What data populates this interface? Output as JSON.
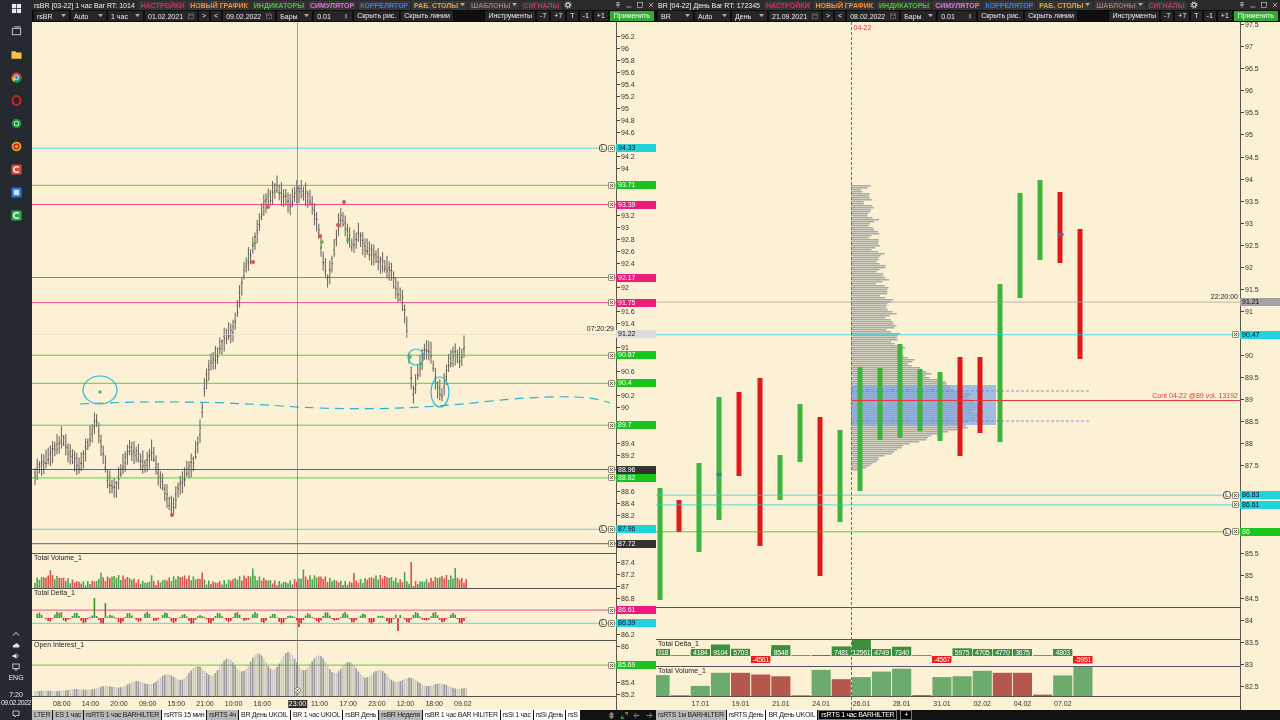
{
  "taskbar": {
    "language": "ENG",
    "time": "7:20",
    "date": "09.02.2022"
  },
  "windows": [
    {
      "kind": "hourly",
      "title": "rsBR [03-22] 1 час Bar RT: 1014",
      "menu": [
        {
          "label": "НАСТРОЙКИ",
          "color": "#e2245e",
          "dropdown": false
        },
        {
          "label": "НОВЫЙ ГРАФИК",
          "color": "#f0903c",
          "dropdown": false
        },
        {
          "label": "ИНДИКАТОРЫ",
          "color": "#4fbf3a",
          "dropdown": false
        },
        {
          "label": "СИМУЛЯТОР",
          "color": "#e070e0",
          "dropdown": false
        },
        {
          "label": "КОРРЕЛЯТОР",
          "color": "#3c7ce0",
          "dropdown": false
        },
        {
          "label": "РАБ. СТОЛЫ",
          "color": "#e0a040",
          "dropdown": true
        },
        {
          "label": "ШАБЛОНЫ",
          "color": "#9a7a6a",
          "dropdown": true
        },
        {
          "label": "СИГНАЛЫ",
          "color": "#c0306a",
          "dropdown": false
        }
      ],
      "toolbar_left": [
        {
          "kind": "select",
          "value": "rsBR"
        },
        {
          "kind": "select",
          "value": "Auto"
        },
        {
          "kind": "select",
          "value": "1 час"
        },
        {
          "kind": "date",
          "value": "01.02.2021"
        },
        {
          "kind": "button",
          "label": ">"
        },
        {
          "kind": "button",
          "label": "<"
        },
        {
          "kind": "date",
          "value": "09.02.2022"
        },
        {
          "kind": "select",
          "value": "Бары"
        },
        {
          "kind": "spin",
          "value": "0.01"
        },
        {
          "kind": "button",
          "label": "Скрыть рис."
        },
        {
          "kind": "button",
          "label": "Скрыть линии"
        }
      ],
      "toolbar_right": [
        {
          "kind": "button",
          "label": "Инструменты"
        },
        {
          "kind": "button",
          "label": "-7"
        },
        {
          "kind": "button",
          "label": "+7"
        },
        {
          "kind": "button",
          "label": "T"
        },
        {
          "kind": "button",
          "label": "-1"
        },
        {
          "kind": "button",
          "label": "+1"
        },
        {
          "kind": "apply",
          "label": "Применить"
        }
      ],
      "price_pane": {
        "chart_data": {
          "type": "bar",
          "categories": [
            null,
            null,
            null,
            null,
            null,
            null,
            null,
            null,
            null,
            null,
            null,
            null,
            null,
            "08:00",
            null,
            null,
            null,
            null,
            null,
            null,
            null,
            null,
            null,
            null,
            null,
            null,
            "14:00",
            null,
            null,
            null,
            null,
            null,
            null,
            null,
            null,
            null,
            null,
            null,
            null,
            "20:00",
            null,
            null,
            null,
            null,
            null,
            null,
            null,
            null,
            null,
            null,
            null,
            null,
            "09:00",
            null,
            null,
            null,
            null,
            null,
            null,
            null,
            null,
            null,
            null,
            null,
            null,
            "15:00",
            null,
            null,
            null,
            null,
            null,
            null,
            null,
            null,
            null,
            null,
            null,
            null,
            "21:00",
            null,
            null,
            null,
            null,
            null,
            null,
            null,
            null,
            null,
            null,
            null,
            null,
            "10:00",
            null,
            null,
            null,
            null,
            null,
            null,
            null,
            null,
            null,
            null,
            null,
            null,
            "16:00",
            null,
            null,
            null,
            null,
            null,
            null,
            null,
            null,
            null,
            null,
            null,
            null,
            null,
            null,
            null,
            null,
            null,
            null,
            null,
            null,
            null,
            null,
            null,
            null,
            null,
            "11:00",
            null,
            null,
            null,
            null,
            null,
            null,
            null,
            null,
            null,
            null,
            null,
            null,
            "17:00",
            null,
            null,
            null,
            null,
            null,
            null,
            null,
            null,
            null,
            null,
            null,
            null,
            "23:00",
            null,
            null,
            null,
            null,
            null,
            null,
            null,
            null,
            null,
            null,
            null,
            null,
            "12:00",
            null,
            null,
            null,
            null,
            null,
            null,
            null,
            null,
            null,
            null,
            null,
            null,
            "18:00",
            null,
            null,
            null,
            null,
            null,
            null,
            null,
            null,
            null,
            null,
            null,
            null,
            "09.02",
            null,
            null,
            null,
            null,
            null,
            null,
            null,
            null,
            null,
            null,
            null,
            null,
            null,
            null,
            null,
            null,
            null,
            null,
            null,
            null,
            null,
            null,
            null,
            null,
            null,
            null,
            null,
            null,
            null,
            null,
            null,
            null,
            null,
            null,
            null,
            null,
            null,
            null,
            null,
            null,
            null,
            null,
            null,
            null,
            null,
            null,
            null,
            null,
            null,
            null,
            null,
            null,
            null,
            null,
            null,
            null,
            null,
            null,
            null,
            null,
            null,
            null,
            null,
            null,
            null,
            null,
            null,
            null,
            null
          ],
          "ylim": [
            84.94,
            96.44
          ],
          "yticks": [
            96.2,
            96,
            95.8,
            95.6,
            95.4,
            95.2,
            95,
            94.8,
            94.6,
            94.2,
            94,
            93.2,
            93,
            92.8,
            92.6,
            92.4,
            92,
            91.6,
            91.4,
            91,
            90.6,
            90.2,
            90,
            89.4,
            89.2,
            88.6,
            88.4,
            88.2,
            87.4,
            87.2,
            87,
            86.8,
            86.2,
            86,
            85.4,
            85.2
          ],
          "ref_lines": [
            {
              "axis": "y",
              "value": 94.33,
              "label": "94.33",
              "color": "#1fd3dc"
            },
            {
              "axis": "y",
              "value": 93.71,
              "label": "93.71",
              "color": "#19c41b"
            },
            {
              "axis": "y",
              "value": 93.39,
              "label": "93.39",
              "color": "#ec1c7c"
            },
            {
              "axis": "y",
              "value": 92.17,
              "label": "92.17",
              "color": "#ec1c7c"
            },
            {
              "axis": "y",
              "value": 91.75,
              "label": "91.75",
              "color": "#ec1c7c"
            },
            {
              "axis": "y",
              "value": 91.22,
              "label": "91.22",
              "color": "#dcdcdc"
            },
            {
              "axis": "y",
              "value": 90.87,
              "label": "90.87",
              "color": "#19c41b"
            },
            {
              "axis": "y",
              "value": 90.4,
              "label": "90.4",
              "color": "#19c41b"
            },
            {
              "axis": "y",
              "value": 89.7,
              "label": "89.7",
              "color": "#19c41b"
            },
            {
              "axis": "y",
              "value": 88.96,
              "label": "88.96",
              "color": "#333333"
            },
            {
              "axis": "y",
              "value": 88.82,
              "label": "88.82",
              "color": "#19c41b"
            },
            {
              "axis": "y",
              "value": 87.96,
              "label": "87.96",
              "color": "#1fd3dc"
            },
            {
              "axis": "y",
              "value": 87.72,
              "label": "87.72",
              "color": "#333333"
            },
            {
              "axis": "y",
              "value": 86.61,
              "label": "86.61",
              "color": "#ec1c7c"
            },
            {
              "axis": "y",
              "value": 86.39,
              "label": "86.39",
              "color": "#1fd3dc"
            },
            {
              "axis": "y",
              "value": 85.69,
              "label": "85.69",
              "color": "#19c41b"
            }
          ],
          "annotations": [
            "23:00"
          ]
        },
        "level_marks": [
          {
            "kind": "tag",
            "lock": "L",
            "closable": true
          },
          {
            "kind": "tag",
            "closable": true
          },
          {
            "kind": "tag",
            "closable": true
          },
          {
            "kind": "tag",
            "closable": true
          },
          {
            "kind": "tag",
            "closable": true
          },
          {
            "kind": "tag",
            "closable": false,
            "time": "07:20:29"
          },
          {
            "kind": "tag",
            "closable": true
          },
          {
            "kind": "tag",
            "closable": true
          },
          {
            "kind": "tag",
            "closable": true
          },
          {
            "kind": "tag",
            "closable": true
          },
          {
            "kind": "tag",
            "closable": true
          },
          {
            "kind": "tag",
            "lock": "L",
            "closable": true
          },
          {
            "kind": "tag",
            "closable": true
          },
          {
            "kind": "tag",
            "closable": true
          },
          {
            "kind": "tag",
            "lock": "L",
            "closable": true
          },
          {
            "kind": "tag",
            "closable": true
          }
        ]
      },
      "panels": [
        {
          "kind": "volume",
          "title": "Total Volume_1"
        },
        {
          "kind": "delta",
          "title": "Total Delta_1"
        },
        {
          "kind": "open_interest",
          "title": "Open Interest_1"
        }
      ]
    },
    {
      "kind": "daily",
      "title": "BR [04-22] День Bar RT: 172345",
      "menu": [
        {
          "label": "НАСТРОЙКИ",
          "color": "#e2245e",
          "dropdown": false
        },
        {
          "label": "НОВЫЙ ГРАФИК",
          "color": "#f0903c",
          "dropdown": false
        },
        {
          "label": "ИНДИКАТОРЫ",
          "color": "#4fbf3a",
          "dropdown": false
        },
        {
          "label": "СИМУЛЯТОР",
          "color": "#e070e0",
          "dropdown": false
        },
        {
          "label": "КОРРЕЛЯТОР",
          "color": "#3c7ce0",
          "dropdown": false
        },
        {
          "label": "РАБ. СТОЛЫ",
          "color": "#e0a040",
          "dropdown": true
        },
        {
          "label": "ШАБЛОНЫ",
          "color": "#9a7a6a",
          "dropdown": true
        },
        {
          "label": "СИГНАЛЫ",
          "color": "#c0306a",
          "dropdown": false
        }
      ],
      "toolbar_left": [
        {
          "kind": "select",
          "value": "BR"
        },
        {
          "kind": "select",
          "value": "Auto"
        },
        {
          "kind": "select",
          "value": "День"
        },
        {
          "kind": "date",
          "value": "21.09.2021"
        },
        {
          "kind": "button",
          "label": ">"
        },
        {
          "kind": "button",
          "label": "<"
        },
        {
          "kind": "date",
          "value": "08.02.2022"
        },
        {
          "kind": "select",
          "value": "Бары"
        },
        {
          "kind": "spin",
          "value": "0.01"
        },
        {
          "kind": "button",
          "label": "Скрыть рис."
        },
        {
          "kind": "button",
          "label": "Скрыть линии"
        }
      ],
      "toolbar_right": [
        {
          "kind": "button",
          "label": "Инструменты"
        },
        {
          "kind": "button",
          "label": "-7"
        },
        {
          "kind": "button",
          "label": "+7"
        },
        {
          "kind": "button",
          "label": "T"
        },
        {
          "kind": "button",
          "label": "-1"
        },
        {
          "kind": "button",
          "label": "+1"
        },
        {
          "kind": "apply",
          "label": "Применить"
        }
      ],
      "price_pane": {
        "chart_data": {
          "type": "bar",
          "categories": [
            null,
            null,
            "17.01",
            null,
            "19.01",
            null,
            "21.01",
            null,
            "24.01",
            null,
            "26.01",
            null,
            "28.01",
            null,
            "31.01",
            null,
            "02.02",
            null,
            "04.02",
            null,
            "07.02",
            null,
            null,
            null,
            null,
            null,
            null,
            null,
            null
          ],
          "ylim": [
            81.96,
            97.56
          ],
          "yticks": [
            97.5,
            97,
            96.5,
            96,
            95.5,
            95,
            94.5,
            94,
            93.5,
            93,
            92.5,
            92,
            91.5,
            91,
            90,
            89.5,
            89,
            88.5,
            88,
            87.5,
            85.5,
            85,
            84.5,
            84,
            83.5,
            83,
            82.5
          ],
          "ref_lines": [
            {
              "axis": "y",
              "value": 91.21,
              "label": "91.21",
              "color": "#a3a3a3"
            },
            {
              "axis": "y",
              "value": 90.47,
              "label": "90.47",
              "color": "#1fd3dc"
            },
            {
              "axis": "y",
              "value": 89,
              "label": "Cont 04-22 @89 vol. 13192",
              "color": "#e23b3b"
            },
            {
              "axis": "y",
              "value": 86.83,
              "label": "86.83",
              "color": "#1fd3dc"
            },
            {
              "axis": "y",
              "value": 86.61,
              "label": "86.61",
              "color": "#1fd3dc"
            },
            {
              "axis": "y",
              "value": 86,
              "label": "86",
              "color": "#19c41b"
            }
          ],
          "annotations": [
            "04-22"
          ]
        },
        "level_marks": [
          {
            "kind": "tag",
            "closable": false,
            "time": "22:20:00"
          },
          {
            "kind": "tag",
            "closable": true
          },
          {
            "kind": "poc"
          },
          {
            "kind": "tag",
            "lock": "L",
            "closable": true
          },
          {
            "kind": "tag",
            "closable": true
          },
          {
            "kind": "tag",
            "lock": "L",
            "closable": true
          }
        ]
      },
      "panels": [
        {
          "kind": "delta_bars",
          "title": "Total Delta_1",
          "bars": [
            {
              "kind": "up",
              "label": "018"
            },
            {
              "kind": "up"
            },
            {
              "kind": "up",
              "label": "4184"
            },
            {
              "kind": "up",
              "label": "9104"
            },
            {
              "kind": "up",
              "label": "5703"
            },
            {
              "kind": "down",
              "label": "-4561"
            },
            {
              "kind": "up",
              "label": "8548"
            },
            {
              "kind": "up"
            },
            {
              "kind": "up"
            },
            {
              "kind": "up",
              "label": "7481"
            },
            {
              "kind": "up",
              "label": "12561"
            },
            {
              "kind": "up",
              "label": "4749"
            },
            {
              "kind": "up",
              "label": "7340"
            },
            {
              "kind": "up"
            },
            {
              "kind": "down",
              "label": "-4567"
            },
            {
              "kind": "up",
              "label": "5975"
            },
            {
              "kind": "up",
              "label": "4705"
            },
            {
              "kind": "up",
              "label": "4770"
            },
            {
              "kind": "up",
              "label": "3675"
            },
            {
              "kind": "up"
            },
            {
              "kind": "up",
              "label": "4803"
            },
            {
              "kind": "down",
              "label": "-5951"
            }
          ]
        },
        {
          "kind": "volume_bars",
          "title": "Total Volume_1"
        }
      ]
    }
  ],
  "tab_bar": {
    "left_tabs": [
      {
        "label": "LTER",
        "highlighted": true,
        "selected": false
      },
      {
        "label": "ES 1 час",
        "highlighted": true,
        "selected": false
      },
      {
        "label": "rsRTS 1 час BARHILTER",
        "highlighted": true,
        "selected": false
      },
      {
        "label": "rsRTS 15 мин",
        "highlighted": false,
        "selected": false
      },
      {
        "label": "rsRTS 4ч",
        "highlighted": true,
        "selected": false
      },
      {
        "label": "BR День UKOIL",
        "highlighted": false,
        "selected": false
      },
      {
        "label": "BR 1 час UKIOL",
        "highlighted": false,
        "selected": false
      },
      {
        "label": "rsBR День",
        "highlighted": false,
        "selected": false
      },
      {
        "label": "rsBR Неделя",
        "highlighted": true,
        "selected": false
      },
      {
        "label": "rsBR 1 час BAR HILITER",
        "highlighted": false,
        "selected": false
      },
      {
        "label": "rsSi 1 час",
        "highlighted": false,
        "selected": false
      },
      {
        "label": "rsSi День",
        "highlighted": false,
        "selected": false
      },
      {
        "label": "rsS",
        "highlighted": false,
        "selected": false
      }
    ],
    "controls": [
      {
        "kind": "vertical",
        "enabled": false
      },
      {
        "kind": "expand",
        "enabled": true
      },
      {
        "kind": "back",
        "enabled": false
      },
      {
        "kind": "forward",
        "enabled": true
      }
    ],
    "right_tabs": [
      {
        "label": "rsRTS 1м BARHILTER",
        "highlighted": true,
        "selected": false
      },
      {
        "label": "rsRTS День",
        "highlighted": false,
        "selected": false
      },
      {
        "label": "BR День UKOIL",
        "highlighted": false,
        "selected": false
      },
      {
        "label": "rsRTS 1 час BARHILTER",
        "highlighted": false,
        "selected": true
      }
    ],
    "add_button": "+"
  }
}
